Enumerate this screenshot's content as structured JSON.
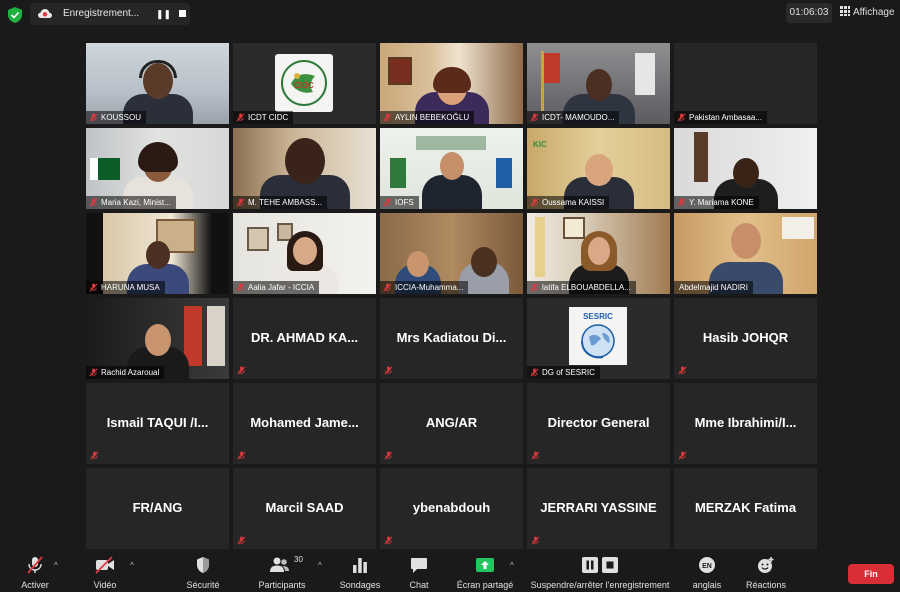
{
  "topbar": {
    "recording_label": "Enregistrement...",
    "timer": "01:06:03",
    "view_label": "Affichage"
  },
  "tiles": [
    {
      "name": "KOUSSOU",
      "muted": true
    },
    {
      "name": "ICDT CIDC",
      "muted": true
    },
    {
      "name": "AYLIN BEBEKOĞLU",
      "muted": true
    },
    {
      "name": "ICDT- MAMOUDO...",
      "muted": true
    },
    {
      "name": "Pakistan Ambasaa...",
      "muted": true
    },
    {
      "name": "Maria Kazi, Minist...",
      "muted": true
    },
    {
      "name": "M. TEHE AMBASS...",
      "muted": true
    },
    {
      "name": "IOFS",
      "muted": true
    },
    {
      "name": "Oussama KAISSI",
      "muted": true
    },
    {
      "name": "Y. Mariama KONE",
      "muted": true
    },
    {
      "name": "HARUNA MUSA",
      "muted": true
    },
    {
      "name": "Aalia Jafar - ICCIA",
      "muted": true
    },
    {
      "name": "ICCIA-Muhamma...",
      "muted": true
    },
    {
      "name": "latifa ELBOUABDELLA...",
      "muted": true
    },
    {
      "name": "Abdelmajid NADIRI",
      "muted": false
    },
    {
      "name": "Rachid Azaroual",
      "muted": true
    },
    {
      "name": "DR. AHMAD KA...",
      "muted": true
    },
    {
      "name": "Mrs Kadiatou Di...",
      "muted": true
    },
    {
      "name": "DG of SESRIC",
      "muted": true
    },
    {
      "name": "Hasib JOHQR",
      "muted": true
    },
    {
      "name": "Ismail TAQUI /I...",
      "muted": true
    },
    {
      "name": "Mohamed Jame...",
      "muted": true
    },
    {
      "name": "ANG/AR",
      "muted": true
    },
    {
      "name": "Director General",
      "muted": true
    },
    {
      "name": "Mme Ibrahimi/I...",
      "muted": true
    },
    {
      "name": "FR/ANG",
      "muted": false
    },
    {
      "name": "Marcil SAAD",
      "muted": true
    },
    {
      "name": "ybenabdouh",
      "muted": true
    },
    {
      "name": "JERRARI YASSINE",
      "muted": true
    },
    {
      "name": "MERZAK Fatima",
      "muted": false
    }
  ],
  "logos": {
    "icdt": "CIDC",
    "kic": "KIC",
    "sesric": "SESRIC"
  },
  "toolbar": {
    "activer": "Activer",
    "video": "Vidéo",
    "securite": "Sécurité",
    "participants": "Participants",
    "participants_count": "30",
    "sondages": "Sondages",
    "chat": "Chat",
    "ecran": "Écran partagé",
    "suspendre": "Suspendre/arrêter l'enregistrement",
    "anglais": "anglais",
    "anglais_badge": "EN",
    "reactions": "Réactions",
    "fin": "Fin"
  },
  "colors": {
    "active_speaker": "#c6d94a",
    "share_green": "#22c55e",
    "end_red": "#d92e36",
    "mute_red": "#e0393e"
  }
}
